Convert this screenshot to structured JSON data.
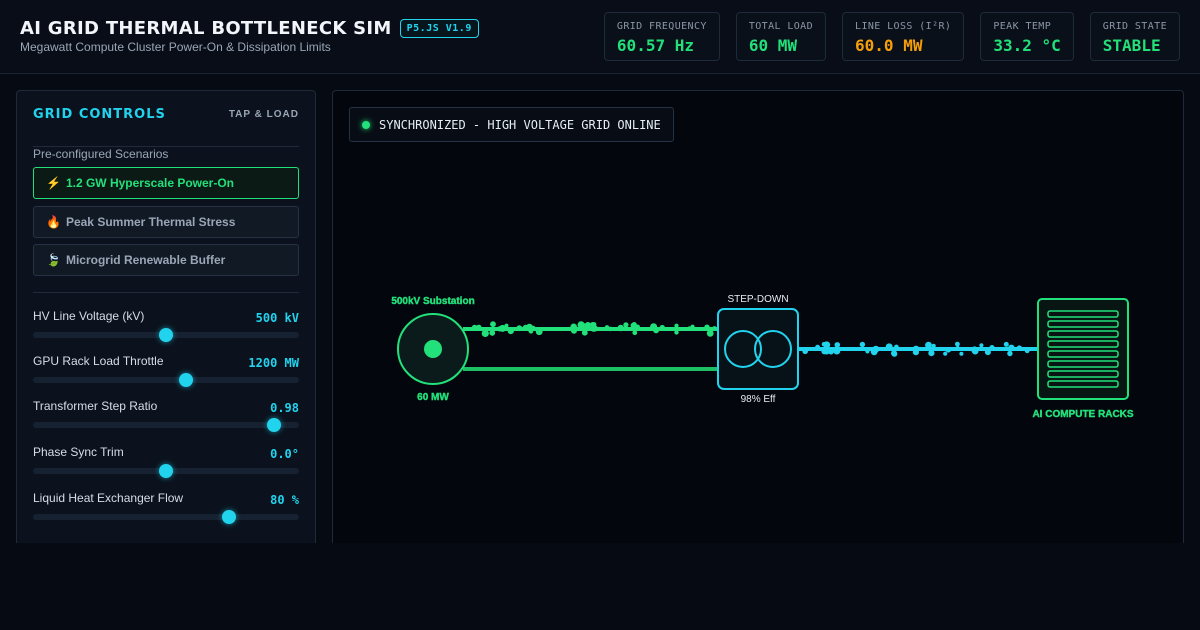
{
  "header": {
    "title": "AI GRID THERMAL BOTTLENECK SIM",
    "badge": "P5.JS V1.9",
    "subtitle": "Megawatt Compute Cluster Power-On & Dissipation Limits",
    "stats": [
      {
        "label": "GRID FREQUENCY",
        "value": "60.57 Hz",
        "color": "#22e07a"
      },
      {
        "label": "TOTAL LOAD",
        "value": "60 MW",
        "color": "#22e07a"
      },
      {
        "label": "LINE LOSS (I²R)",
        "value": "60.0 MW",
        "color": "#f59e0b"
      },
      {
        "label": "PEAK TEMP",
        "value": "33.2 °C",
        "color": "#22e07a"
      },
      {
        "label": "GRID STATE",
        "value": "STABLE",
        "color": "#22e07a"
      }
    ]
  },
  "controls": {
    "title": "GRID CONTROLS",
    "tag": "TAP & LOAD",
    "scenarios_label": "Pre-configured Scenarios",
    "scenarios": [
      {
        "icon": "⚡",
        "icon_name": "lightning-icon",
        "label": "1.2 GW Hyperscale Power-On",
        "active": true
      },
      {
        "icon": "🔥",
        "icon_name": "fire-icon",
        "label": "Peak Summer Thermal Stress",
        "active": false
      },
      {
        "icon": "🍃",
        "icon_name": "leaf-icon",
        "label": "Microgrid Renewable Buffer",
        "active": false
      }
    ],
    "sliders": [
      {
        "label": "HV Line Voltage (kV)",
        "value": "500 kV",
        "level": 0.5
      },
      {
        "label": "GPU Rack Load Throttle",
        "value": "1200 MW",
        "level": 0.575
      },
      {
        "label": "Transformer Step Ratio",
        "value": "0.98",
        "level": 0.905
      },
      {
        "label": "Phase Sync Trim",
        "value": "0.0°",
        "level": 0.5
      },
      {
        "label": "Liquid Heat Exchanger Flow",
        "value": "80 %",
        "level": 0.737
      }
    ]
  },
  "sim": {
    "status": "SYNCHRONIZED - HIGH VOLTAGE GRID ONLINE",
    "substation_label": "500kV Substation",
    "substation_load": "60 MW",
    "transformer_label": "STEP-DOWN",
    "transformer_eff": "98% Eff",
    "racks_label": "AI COMPUTE RACKS",
    "colors": {
      "hv": "#22e07a",
      "lv": "#22d3ee"
    }
  }
}
